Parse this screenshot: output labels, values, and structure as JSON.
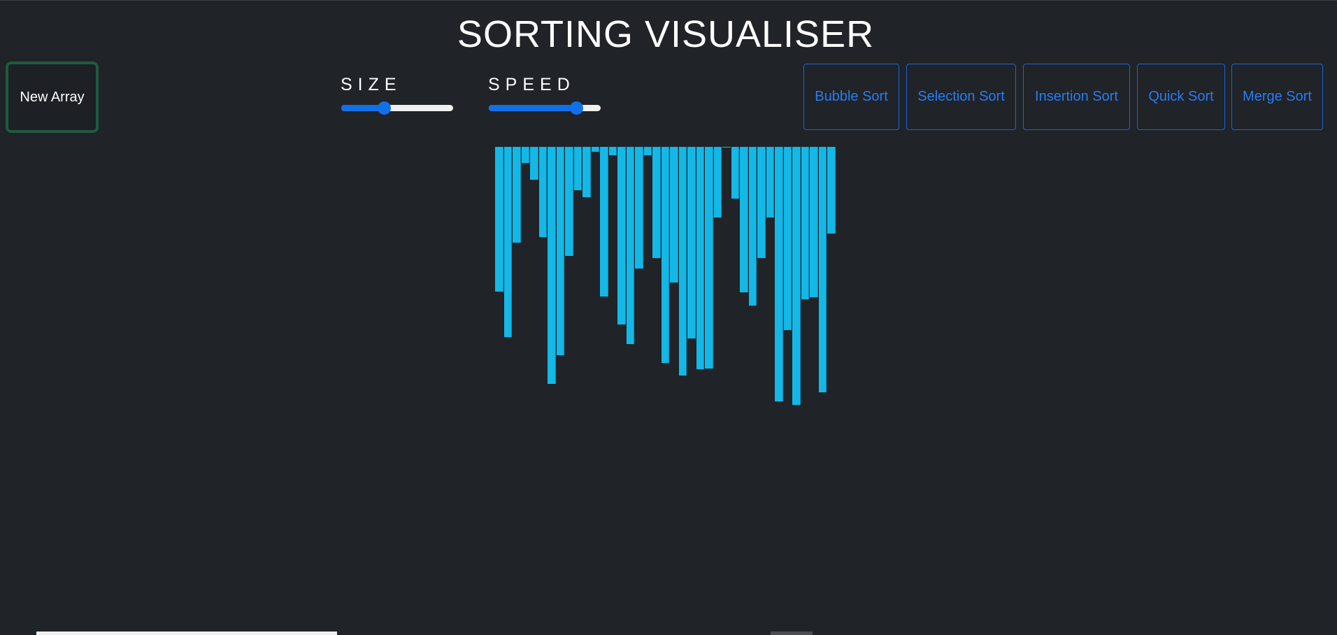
{
  "header": {
    "title": "SORTING VISUALISER"
  },
  "controls": {
    "new_array_label": "New Array",
    "size_label": "SIZE",
    "speed_label": "SPEED",
    "size_value": 0.38,
    "speed_value": 0.78
  },
  "algorithms": [
    {
      "label": "Bubble Sort"
    },
    {
      "label": "Selection Sort"
    },
    {
      "label": "Insertion Sort"
    },
    {
      "label": "Quick Sort"
    },
    {
      "label": "Merge Sort"
    }
  ],
  "array": [
    207,
    272,
    137,
    23,
    47,
    129,
    339,
    298,
    156,
    62,
    72,
    7,
    214,
    12,
    254,
    282,
    174,
    12,
    159,
    309,
    194,
    327,
    274,
    318,
    317,
    101,
    0,
    74,
    208,
    227,
    159,
    101,
    364,
    262,
    369,
    218,
    215,
    351,
    124
  ],
  "colors": {
    "bar": "#13b8e6",
    "accent": "#1170e8",
    "background": "#202328"
  }
}
